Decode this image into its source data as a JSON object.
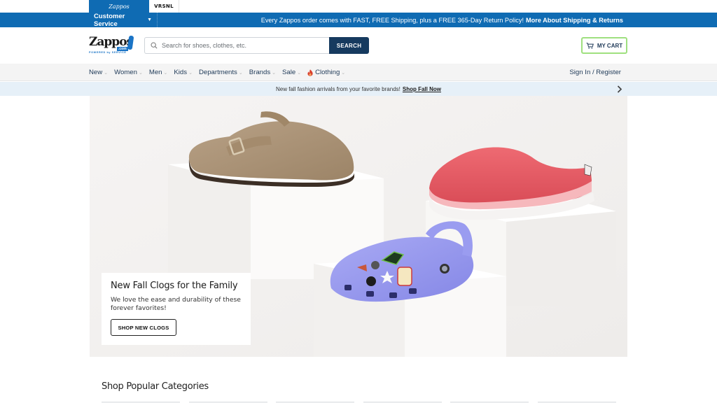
{
  "brand_tabs": [
    {
      "label": "Zappos",
      "active": true
    },
    {
      "label": "VRSNL",
      "active": false
    }
  ],
  "service_bar": {
    "customer_service_label": "Customer Service",
    "promo_text": "Every Zappos order comes with FAST, FREE Shipping, plus a FREE 365-Day Return Policy!",
    "promo_link": "More About Shipping & Returns"
  },
  "header": {
    "logo": {
      "word": "Zappos",
      "com": ".com",
      "tagline": "POWERED by SERVICE"
    },
    "search": {
      "placeholder": "Search for shoes, clothes, etc.",
      "value": "",
      "button_label": "SEARCH"
    },
    "cart_label": "MY CART"
  },
  "nav": {
    "items": [
      {
        "label": "New",
        "icon": null
      },
      {
        "label": "Women",
        "icon": null
      },
      {
        "label": "Men",
        "icon": null
      },
      {
        "label": "Kids",
        "icon": null
      },
      {
        "label": "Departments",
        "icon": null
      },
      {
        "label": "Brands",
        "icon": null
      },
      {
        "label": "Sale",
        "icon": null
      },
      {
        "label": "Clothing",
        "icon": "fire-icon"
      }
    ],
    "sign_in_label": "Sign In / Register"
  },
  "announcement": {
    "text": "New fall fashion arrivals from your favorite brands!",
    "link": "Shop Fall Now"
  },
  "hero": {
    "title": "New Fall Clogs for the Family",
    "description": "We love the ease and durability of these forever favorites!",
    "button_label": "SHOP NEW CLOGS",
    "products": [
      "tan suede clog",
      "coral rubber garden clog",
      "lavender kids clog with charms"
    ]
  },
  "popular": {
    "title": "Shop Popular Categories",
    "tile_count": 6
  },
  "colors": {
    "brand_blue": "#0f6bb3",
    "search_button": "#163a5f",
    "cart_border": "#9fe07f",
    "announce_bg": "#e6f0f8",
    "nav_text": "#1f3a58"
  }
}
